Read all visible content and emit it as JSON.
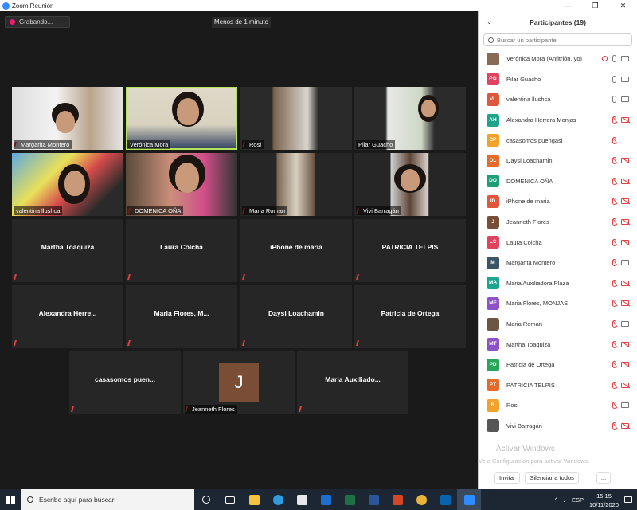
{
  "window": {
    "title": "Zoom Reunión",
    "controls": [
      "—",
      "❐",
      "✕"
    ]
  },
  "meeting": {
    "recording_label": "Grabando...",
    "timer": "Menos de 1 minuto",
    "video_tiles": [
      {
        "name": "Margarita Montero"
      },
      {
        "name": "Verónica Mora"
      },
      {
        "name": "Rosi"
      },
      {
        "name": "Pilar Guacho"
      },
      {
        "name": "valentina llushca"
      },
      {
        "name": "DOMENICA OÑA"
      },
      {
        "name": "Maria Roman"
      },
      {
        "name": "Vivi Barragán"
      }
    ],
    "name_tiles": [
      "Martha Toaquiza",
      "Laura Colcha",
      "iPhone de maria",
      "PATRICIA TELPIS",
      "Alexandra  Herre...",
      "Maria  Flores,  M...",
      "Daysi Loachamin",
      "Patricia de Ortega",
      "casasomos  puen...",
      "Maria  Auxiliado..."
    ],
    "avatar_tile": {
      "initial": "J",
      "name": "Jeanneth Flores"
    }
  },
  "participants": {
    "title": "Participantes (19)",
    "search_placeholder": "Buscar un participante",
    "list": [
      {
        "initials": "",
        "name": "Verónica Mora (Anfitrión, yo)",
        "color": "#8a6a55",
        "mic": "on",
        "cam": "on",
        "rec": true
      },
      {
        "initials": "PG",
        "name": "Pilar Guacho",
        "color": "#e0435e",
        "mic": "on",
        "cam": "on"
      },
      {
        "initials": "VL",
        "name": "valentina llushca",
        "color": "#e0573b",
        "mic": "on",
        "cam": "on"
      },
      {
        "initials": "AH",
        "name": "Alexandra Herrera Monjas",
        "color": "#1fa38b",
        "mic": "off",
        "cam": "off"
      },
      {
        "initials": "CP",
        "name": "casasomos puengasi",
        "color": "#f2a12a",
        "mic": "off",
        "cam": "none"
      },
      {
        "initials": "DL",
        "name": "Daysi Loachamin",
        "color": "#e46b2a",
        "mic": "off",
        "cam": "off"
      },
      {
        "initials": "DO",
        "name": "DOMENICA OÑA",
        "color": "#1e9e77",
        "mic": "off",
        "cam": "off"
      },
      {
        "initials": "ID",
        "name": "iPhone de maria",
        "color": "#e0573b",
        "mic": "off",
        "cam": "off"
      },
      {
        "initials": "J",
        "name": "Jeanneth Flores",
        "color": "#7a4d36",
        "mic": "off",
        "cam": "off"
      },
      {
        "initials": "LC",
        "name": "Laura Colcha",
        "color": "#e0435e",
        "mic": "off",
        "cam": "off"
      },
      {
        "initials": "M",
        "name": "Margarita Montero",
        "color": "#3a5566",
        "mic": "off",
        "cam": "on"
      },
      {
        "initials": "MA",
        "name": "Maria Auxiliadora Plaza",
        "color": "#19a58f",
        "mic": "off",
        "cam": "off"
      },
      {
        "initials": "MF",
        "name": "Maria Flores, MONJAS",
        "color": "#8d52c7",
        "mic": "off",
        "cam": "off"
      },
      {
        "initials": "",
        "name": "Maria Roman",
        "color": "#6b5644",
        "mic": "off",
        "cam": "on"
      },
      {
        "initials": "MT",
        "name": "Martha Toaquiza",
        "color": "#8d52c7",
        "mic": "off",
        "cam": "off"
      },
      {
        "initials": "PD",
        "name": "Patricia de Ortega",
        "color": "#27a65a",
        "mic": "off",
        "cam": "off"
      },
      {
        "initials": "PT",
        "name": "PATRICIA TELPIS",
        "color": "#e46b2a",
        "mic": "off",
        "cam": "off"
      },
      {
        "initials": "R",
        "name": "Rosi",
        "color": "#f2a12a",
        "mic": "off",
        "cam": "on"
      },
      {
        "initials": "",
        "name": "Vivi Barragán",
        "color": "#555555",
        "mic": "off",
        "cam": "off"
      }
    ],
    "invite_label": "Invitar",
    "mute_all_label": "Silenciar a todos",
    "more_label": "..."
  },
  "watermark": {
    "line1": "Activar Windows",
    "line2": "Ve a Configuración para activar Windows."
  },
  "taskbar": {
    "search_text": "Escribe aquí para buscar",
    "tray_lang": "ESP",
    "time": "15:15",
    "date": "10/11/2020"
  }
}
